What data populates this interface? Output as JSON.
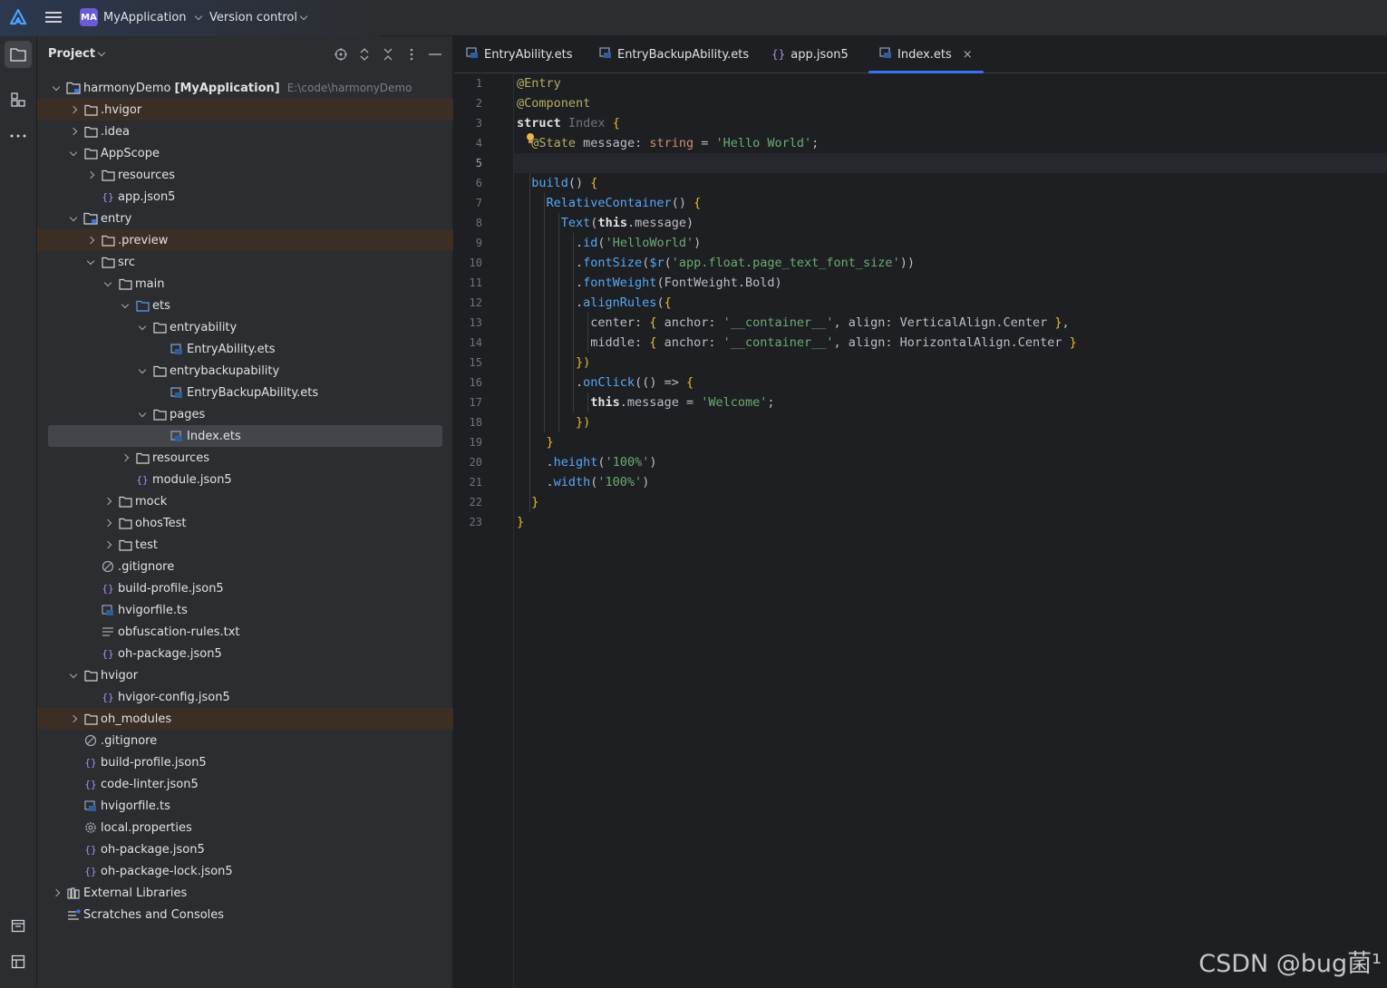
{
  "titlebar": {
    "project_badge": "MA",
    "project_name": "MyApplication",
    "vcs_label": "Version control"
  },
  "project_panel": {
    "title": "Project"
  },
  "tree": {
    "root_name": "harmonyDemo",
    "root_module": "[MyApplication]",
    "root_path": "E:\\code\\harmonyDemo",
    "items": [
      {
        "label": ".hvigor"
      },
      {
        "label": ".idea"
      },
      {
        "label": "AppScope"
      },
      {
        "label": "resources"
      },
      {
        "label": "app.json5"
      },
      {
        "label": "entry"
      },
      {
        "label": ".preview"
      },
      {
        "label": "src"
      },
      {
        "label": "main"
      },
      {
        "label": "ets"
      },
      {
        "label": "entryability"
      },
      {
        "label": "EntryAbility.ets"
      },
      {
        "label": "entrybackupability"
      },
      {
        "label": "EntryBackupAbility.ets"
      },
      {
        "label": "pages"
      },
      {
        "label": "Index.ets"
      },
      {
        "label": "resources"
      },
      {
        "label": "module.json5"
      },
      {
        "label": "mock"
      },
      {
        "label": "ohosTest"
      },
      {
        "label": "test"
      },
      {
        "label": ".gitignore"
      },
      {
        "label": "build-profile.json5"
      },
      {
        "label": "hvigorfile.ts"
      },
      {
        "label": "obfuscation-rules.txt"
      },
      {
        "label": "oh-package.json5"
      },
      {
        "label": "hvigor"
      },
      {
        "label": "hvigor-config.json5"
      },
      {
        "label": "oh_modules"
      },
      {
        "label": ".gitignore"
      },
      {
        "label": "build-profile.json5"
      },
      {
        "label": "code-linter.json5"
      },
      {
        "label": "hvigorfile.ts"
      },
      {
        "label": "local.properties"
      },
      {
        "label": "oh-package.json5"
      },
      {
        "label": "oh-package-lock.json5"
      },
      {
        "label": "External Libraries"
      },
      {
        "label": "Scratches and Consoles"
      }
    ]
  },
  "tabs": [
    {
      "label": "EntryAbility.ets"
    },
    {
      "label": "EntryBackupAbility.ets"
    },
    {
      "label": "app.json5"
    },
    {
      "label": "Index.ets",
      "close": "×"
    }
  ],
  "editor": {
    "current_line": "5",
    "line_numbers": [
      "1",
      "2",
      "3",
      "4",
      "5",
      "6",
      "7",
      "8",
      "9",
      "10",
      "11",
      "12",
      "13",
      "14",
      "15",
      "16",
      "17",
      "18",
      "19",
      "20",
      "21",
      "22",
      "23"
    ]
  },
  "watermark": "CSDN @bug菌¹",
  "colors": {
    "accent": "#3574f0",
    "highlight_row": "#3b2e24",
    "selected_row": "#43454a"
  }
}
